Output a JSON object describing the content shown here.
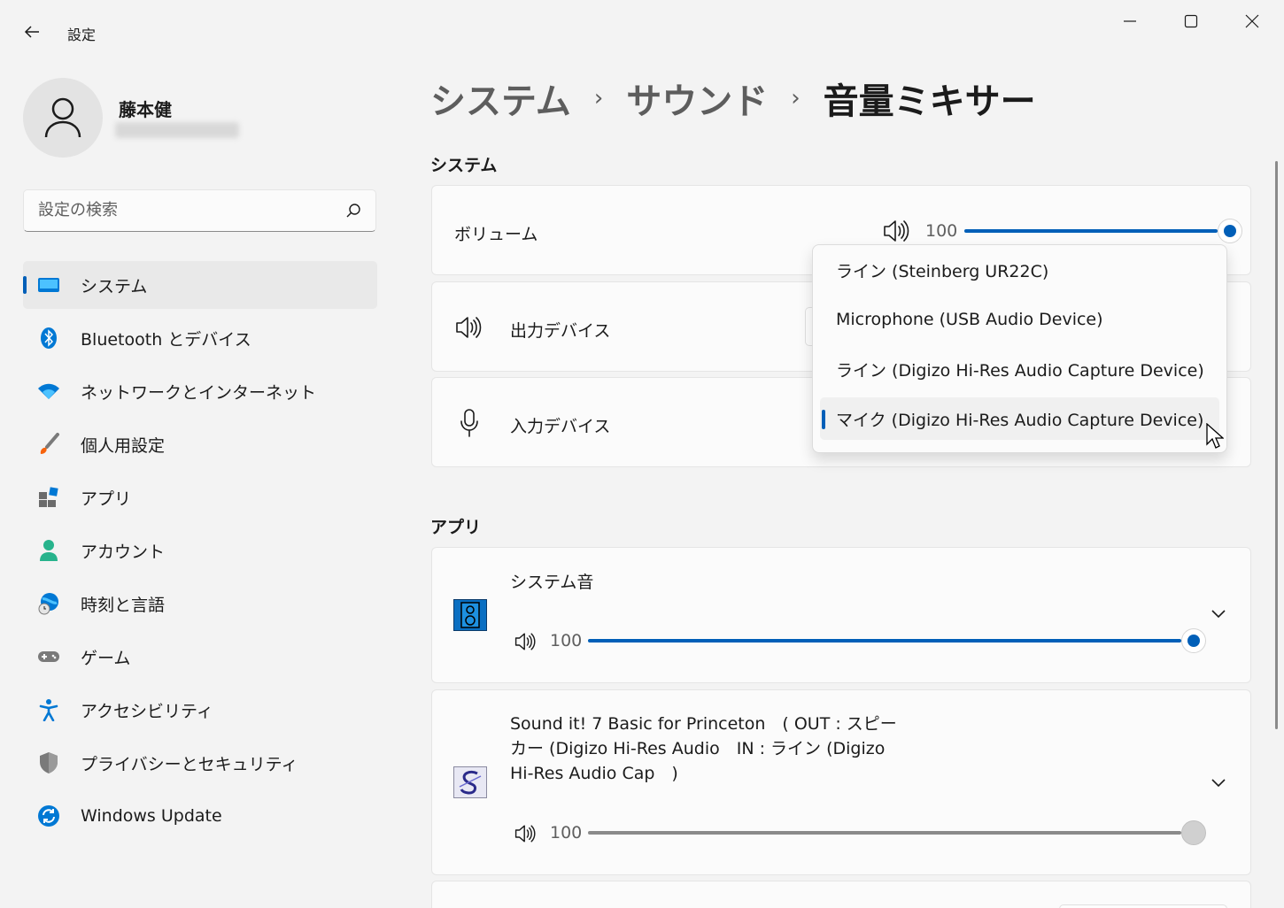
{
  "window": {
    "title": "設定"
  },
  "profile": {
    "name": "藤本健"
  },
  "search": {
    "placeholder": "設定の検索"
  },
  "sidebar": {
    "items": [
      {
        "label": "システム",
        "icon": "system-icon",
        "active": true
      },
      {
        "label": "Bluetooth とデバイス",
        "icon": "bluetooth-icon"
      },
      {
        "label": "ネットワークとインターネット",
        "icon": "wifi-icon"
      },
      {
        "label": "個人用設定",
        "icon": "brush-icon"
      },
      {
        "label": "アプリ",
        "icon": "apps-icon"
      },
      {
        "label": "アカウント",
        "icon": "account-icon"
      },
      {
        "label": "時刻と言語",
        "icon": "globe-clock-icon"
      },
      {
        "label": "ゲーム",
        "icon": "gamepad-icon"
      },
      {
        "label": "アクセシビリティ",
        "icon": "accessibility-icon"
      },
      {
        "label": "プライバシーとセキュリティ",
        "icon": "shield-icon"
      },
      {
        "label": "Windows Update",
        "icon": "update-icon"
      }
    ]
  },
  "breadcrumb": {
    "items": [
      "システム",
      "サウンド",
      "音量ミキサー"
    ],
    "separator": "›"
  },
  "system_section": {
    "title": "システム",
    "volume": {
      "label": "ボリューム",
      "value": "100",
      "level": 1.0
    },
    "output": {
      "label": "出力デバイス"
    },
    "input": {
      "label": "入力デバイス"
    }
  },
  "input_dropdown": {
    "options": [
      "ライン (Steinberg UR22C)",
      "Microphone (USB Audio Device)",
      "ライン (Digizo Hi-Res Audio Capture Device)",
      "マイク (Digizo Hi-Res Audio Capture Device)"
    ],
    "selected_index": 3
  },
  "apps_section": {
    "title": "アプリ",
    "apps": [
      {
        "name": "システム音",
        "volume": "100",
        "level": 1.0,
        "active": true
      },
      {
        "name_lines": [
          "Sound it! 7 Basic for Princeton　( OUT : スピー",
          "カー (Digizo Hi-Res Audio　IN : ライン (Digizo",
          "Hi-Res Audio Cap　)"
        ],
        "volume": "100",
        "level": 1.0,
        "active": false
      }
    ]
  },
  "colors": {
    "accent": "#005fb8",
    "background": "#f3f3f3",
    "card": "#fbfbfb",
    "inactive_slider": "#8a8a8a"
  }
}
